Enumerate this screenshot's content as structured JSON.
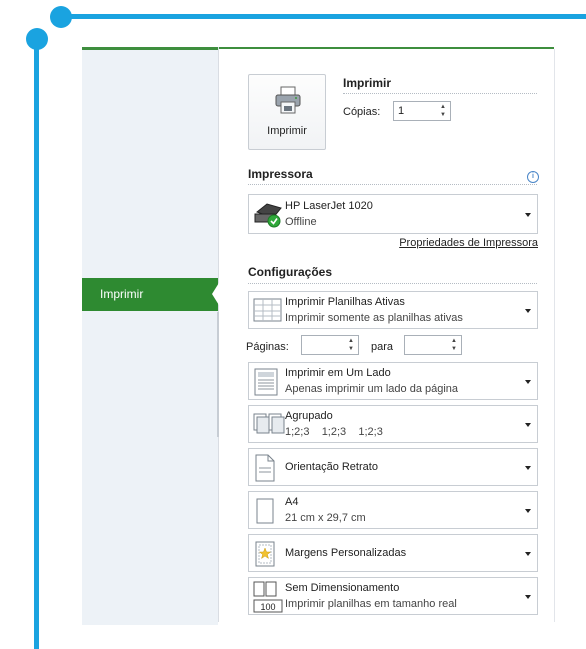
{
  "nav": {
    "print_item": "Imprimir"
  },
  "print_panel": {
    "button_label": "Imprimir",
    "title": "Imprimir",
    "copies_label": "Cópias:",
    "copies_value": "1"
  },
  "printer_section": {
    "title": "Impressora",
    "printer_name": "HP LaserJet 1020",
    "printer_status": "Offline",
    "properties_link": "Propriedades de Impressora"
  },
  "settings_section": {
    "title": "Configurações",
    "pages_label": "Páginas:",
    "to_label": "para",
    "options": [
      {
        "title": "Imprimir Planilhas Ativas",
        "subtitle": "Imprimir somente as planilhas ativas",
        "icon": "sheets-icon"
      },
      {
        "title": "Imprimir em Um Lado",
        "subtitle": "Apenas imprimir um lado da página",
        "icon": "one-side-icon"
      },
      {
        "title": "Agrupado",
        "subtitle": "1;2;3    1;2;3    1;2;3",
        "icon": "collated-icon"
      },
      {
        "title": "Orientação Retrato",
        "subtitle": "",
        "icon": "portrait-icon"
      },
      {
        "title": "A4",
        "subtitle": "21 cm x 29,7 cm",
        "icon": "paper-size-icon"
      },
      {
        "title": "Margens Personalizadas",
        "subtitle": "",
        "icon": "margins-icon"
      },
      {
        "title": "Sem Dimensionamento",
        "subtitle": "Imprimir planilhas em tamanho real",
        "icon": "scaling-icon",
        "badge": "100"
      }
    ]
  },
  "colors": {
    "accent_green": "#2e8a31",
    "frame_blue": "#1aa3e0",
    "status_green": "#2fa83a"
  }
}
